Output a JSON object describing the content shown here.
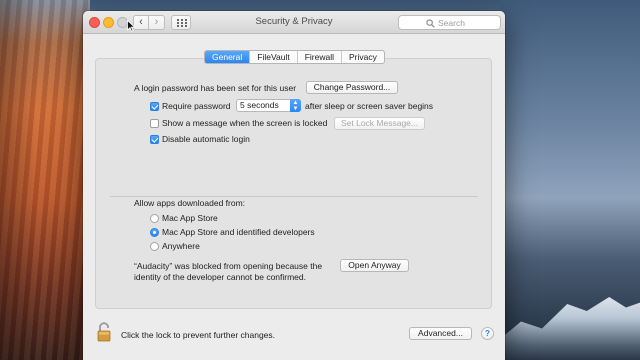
{
  "window": {
    "title": "Security & Privacy",
    "search_placeholder": "Search"
  },
  "tabs": [
    {
      "label": "General",
      "active": true
    },
    {
      "label": "FileVault",
      "active": false
    },
    {
      "label": "Firewall",
      "active": false
    },
    {
      "label": "Privacy",
      "active": false
    }
  ],
  "general": {
    "login_password_text": "A login password has been set for this user",
    "change_password_button": "Change Password...",
    "require_password": {
      "label": "Require password",
      "checked": true
    },
    "require_password_delay": "5 seconds",
    "require_password_suffix": "after sleep or screen saver begins",
    "show_message": {
      "label": "Show a message when the screen is locked",
      "checked": false
    },
    "set_lock_message_button": "Set Lock Message...",
    "disable_auto_login": {
      "label": "Disable automatic login",
      "checked": true
    },
    "allow_apps_heading": "Allow apps downloaded from:",
    "allow_apps_options": [
      {
        "label": "Mac App Store",
        "selected": false
      },
      {
        "label": "Mac App Store and identified developers",
        "selected": true
      },
      {
        "label": "Anywhere",
        "selected": false
      }
    ],
    "blocked_line1": "“Audacity” was blocked from opening because the",
    "blocked_line2": "identity of the developer cannot be confirmed.",
    "open_anyway_button": "Open Anyway"
  },
  "footer": {
    "lock_text": "Click the lock to prevent further changes.",
    "advanced_button": "Advanced...",
    "help_label": "?"
  },
  "colors": {
    "accent": "#2b86f3",
    "close": "#fc5f57",
    "minimize": "#fdbc2e"
  },
  "icons": [
    "close-icon",
    "minimize-icon",
    "zoom-icon",
    "chevron-left-icon",
    "chevron-right-icon",
    "grid-icon",
    "search-icon",
    "lock-icon",
    "help-icon",
    "cursor-icon"
  ]
}
